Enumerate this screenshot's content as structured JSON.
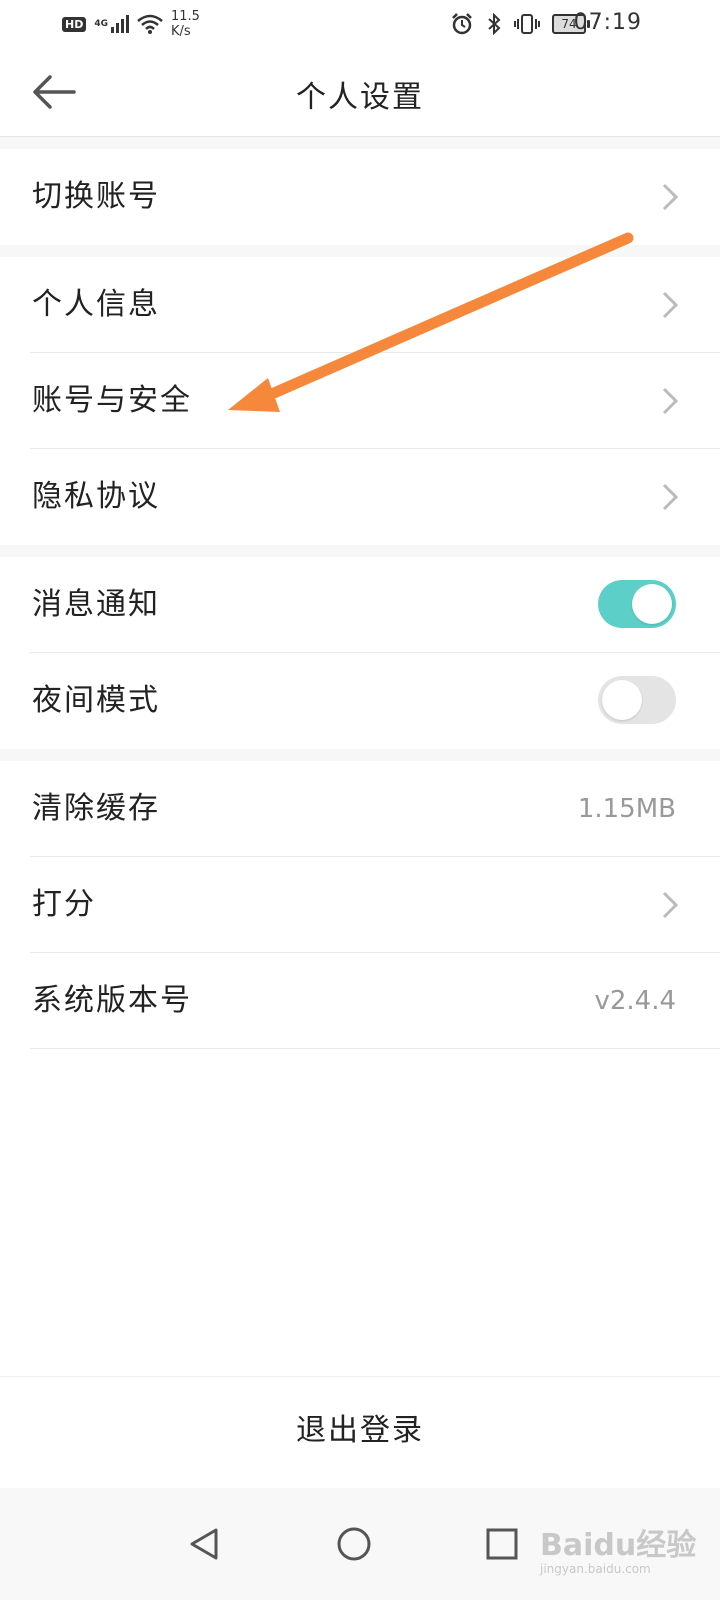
{
  "status": {
    "hd": "HD",
    "network": "4G",
    "speed_value": "11.5",
    "speed_unit": "K/s",
    "battery": "74",
    "time": "07:19"
  },
  "header": {
    "title": "个人设置"
  },
  "groups": {
    "switch_account": "切换账号",
    "personal_info": "个人信息",
    "account_security": "账号与安全",
    "privacy": "隐私协议",
    "notifications": "消息通知",
    "notifications_on": true,
    "night_mode": "夜间模式",
    "night_mode_on": false,
    "clear_cache": "清除缓存",
    "cache_size": "1.15MB",
    "rate": "打分",
    "version_label": "系统版本号",
    "version_value": "v2.4.4"
  },
  "logout": "退出登录",
  "watermark": {
    "main": "Baidu经验",
    "sub": "jingyan.baidu.com"
  },
  "colors": {
    "toggle_on": "#5ccfc9",
    "toggle_off": "#e4e4e4",
    "annotation_arrow": "#f5883a"
  },
  "icons": {
    "back": "arrow-left-icon",
    "chevron": "chevron-right-icon",
    "nav_back": "triangle-back-icon",
    "nav_home": "circle-home-icon",
    "nav_recent": "square-recent-icon"
  }
}
